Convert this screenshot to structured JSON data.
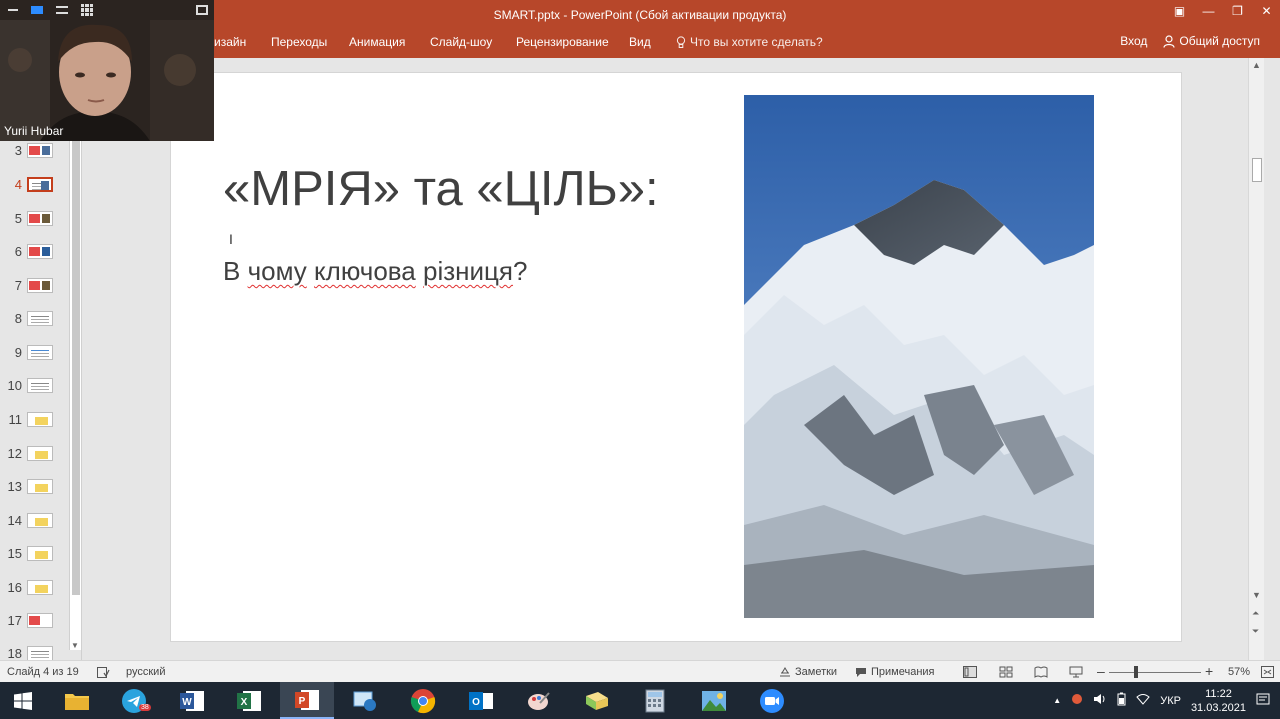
{
  "window": {
    "title": "SMART.pptx - PowerPoint (Сбой активации продукта)"
  },
  "ribbon": {
    "tabs": [
      "изайн",
      "Переходы",
      "Анимация",
      "Слайд-шоу",
      "Рецензирование",
      "Вид"
    ],
    "tell_me": "Что вы хотите сделать?",
    "signin": "Вход",
    "share": "Общий доступ"
  },
  "thumbnails": [
    {
      "num": "3",
      "style": "red-img"
    },
    {
      "num": "4",
      "style": "selected"
    },
    {
      "num": "5",
      "style": "red-img"
    },
    {
      "num": "6",
      "style": "red-img"
    },
    {
      "num": "7",
      "style": "red-img"
    },
    {
      "num": "8",
      "style": "text"
    },
    {
      "num": "9",
      "style": "text"
    },
    {
      "num": "10",
      "style": "text"
    },
    {
      "num": "11",
      "style": "yellow"
    },
    {
      "num": "12",
      "style": "yellow"
    },
    {
      "num": "13",
      "style": "yellow"
    },
    {
      "num": "14",
      "style": "yellow"
    },
    {
      "num": "15",
      "style": "yellow"
    },
    {
      "num": "16",
      "style": "yellow"
    },
    {
      "num": "17",
      "style": "red-img"
    },
    {
      "num": "18",
      "style": "text"
    }
  ],
  "slide": {
    "title": "«МРІЯ» та «ЦІЛЬ»:",
    "body_prefix": "В ",
    "body_words": [
      "чому",
      "ключова",
      "різниця"
    ],
    "body_suffix": "?"
  },
  "statusbar": {
    "slide_info": "Слайд 4 из 19",
    "language": "русский",
    "notes": "Заметки",
    "comments": "Примечания",
    "zoom": "57%"
  },
  "webcam": {
    "name": "Yurii Hubar"
  },
  "taskbar": {
    "apps": [
      "file-explorer",
      "telegram",
      "word",
      "excel",
      "powerpoint",
      "remote-desktop",
      "chrome",
      "outlook",
      "paint",
      "folder",
      "calculator",
      "photo-viewer",
      "zoom"
    ],
    "telegram_badge": "38",
    "language": "УКР",
    "time": "11:22",
    "date": "31.03.2021"
  },
  "colors": {
    "ribbon": "#b7472a",
    "accent": "#c43e1c",
    "taskbar": "#1d2733"
  }
}
